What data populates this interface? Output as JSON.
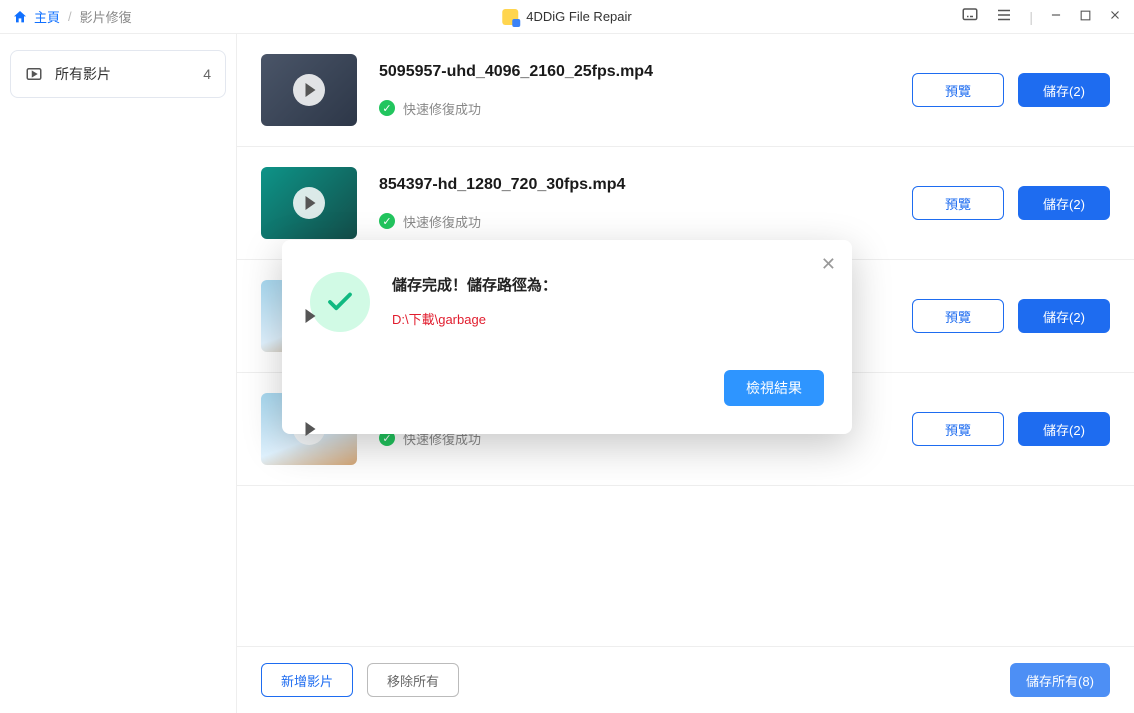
{
  "titlebar": {
    "home": "主頁",
    "current": "影片修復",
    "app_name": "4DDiG File Repair"
  },
  "sidebar": {
    "all_videos_label": "所有影片",
    "all_videos_count": "4"
  },
  "files": [
    {
      "name": "5095957-uhd_4096_2160_25fps.mp4",
      "status": "快速修復成功",
      "preview": "預覽",
      "save": "儲存(2)"
    },
    {
      "name": "854397-hd_1280_720_30fps.mp4",
      "status": "快速修復成功",
      "preview": "預覽",
      "save": "儲存(2)"
    },
    {
      "name": "",
      "status": "",
      "preview": "預覽",
      "save": "儲存(2)"
    },
    {
      "name": "",
      "status": "快速修復成功",
      "preview": "預覽",
      "save": "儲存(2)"
    }
  ],
  "footer": {
    "add": "新增影片",
    "remove_all": "移除所有",
    "save_all": "儲存所有(8)"
  },
  "modal": {
    "title": "儲存完成！儲存路徑為：",
    "path": "D:\\下載\\garbage",
    "view_result": "檢視結果"
  }
}
